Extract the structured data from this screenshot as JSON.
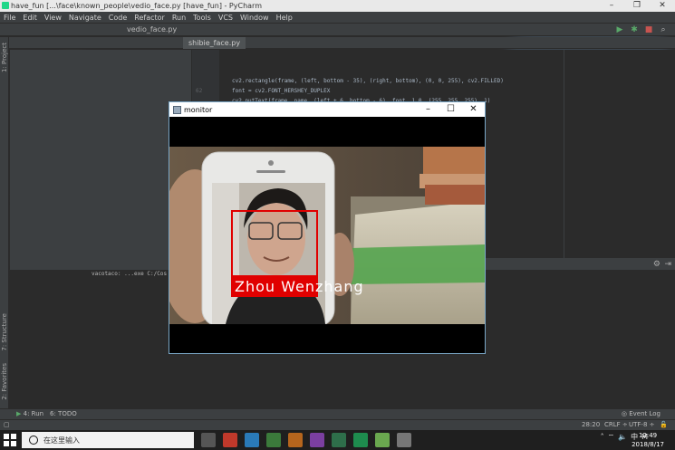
{
  "pycharm": {
    "title": "have_fun [...\\face\\known_people\\vedio_face.py [have_fun] - PyCharm",
    "menu": [
      "File",
      "Edit",
      "View",
      "Navigate",
      "Code",
      "Refactor",
      "Run",
      "Tools",
      "VCS",
      "Window",
      "Help"
    ],
    "breadcrumb": "vedio_face.py",
    "tab": "shibie_face.py",
    "code_lines": [
      "cv2.rectangle(frame, (left, bottom - 35), (right, bottom), (0, 0, 255), cv2.FILLED)",
      "font = cv2.FONT_HERSHEY_DUPLEX",
      "cv2.putText(frame, name, (left + 6, bottom - 6), font, 1.0, (255, 255, 255), 1)"
    ],
    "line_number": "62",
    "run_output": "vacotaco: ...exe C:/Cos",
    "left_labels": {
      "project": "1: Project",
      "structure": "7: Structure",
      "favorites": "2: Favorites"
    },
    "bottom_tabs": {
      "run": "4: Run",
      "todo": "6: TODO"
    },
    "event_log": "Event Log",
    "status": {
      "position": "28:20",
      "line_sep": "CRLF ÷",
      "encoding": "UTF-8 ÷"
    }
  },
  "monitor": {
    "title": "monitor",
    "label_text": "Zhou Wenzhang",
    "box_color": "#e00000"
  },
  "taskbar": {
    "search_placeholder": "在这里输入",
    "ime": "中",
    "time": "12:49",
    "date": "2018/8/17"
  }
}
